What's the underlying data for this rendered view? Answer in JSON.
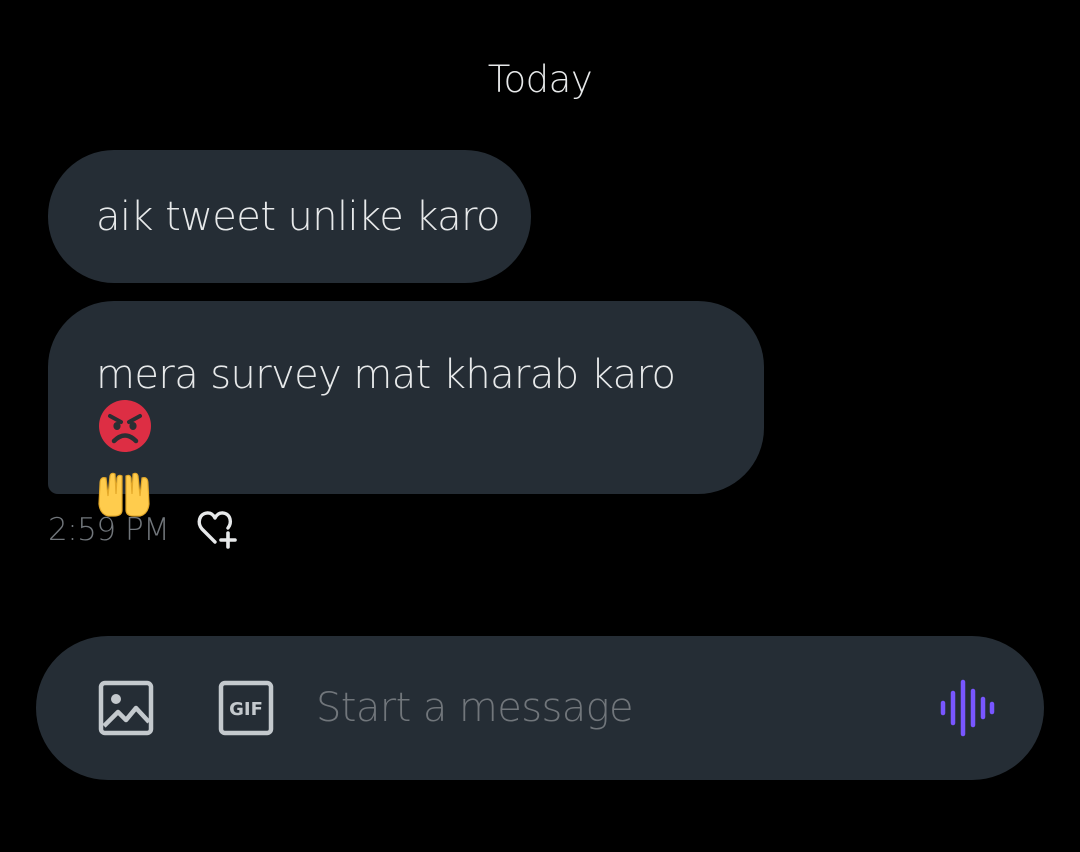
{
  "conversation": {
    "date_divider": "Today",
    "messages": [
      {
        "text": "aik tweet unlike karo"
      },
      {
        "text": "mera survey mat kharab karo",
        "emojis": [
          "angry-face",
          "palms-up-together"
        ]
      }
    ],
    "last_message_time": "2:59 PM"
  },
  "composer": {
    "placeholder": "Start a message",
    "gif_label": "GIF",
    "accent_color": "#7856ff"
  },
  "theme": {
    "background": "#000000",
    "bubble": "#252d35",
    "text": "#e7e9ea",
    "muted": "#71767b"
  }
}
